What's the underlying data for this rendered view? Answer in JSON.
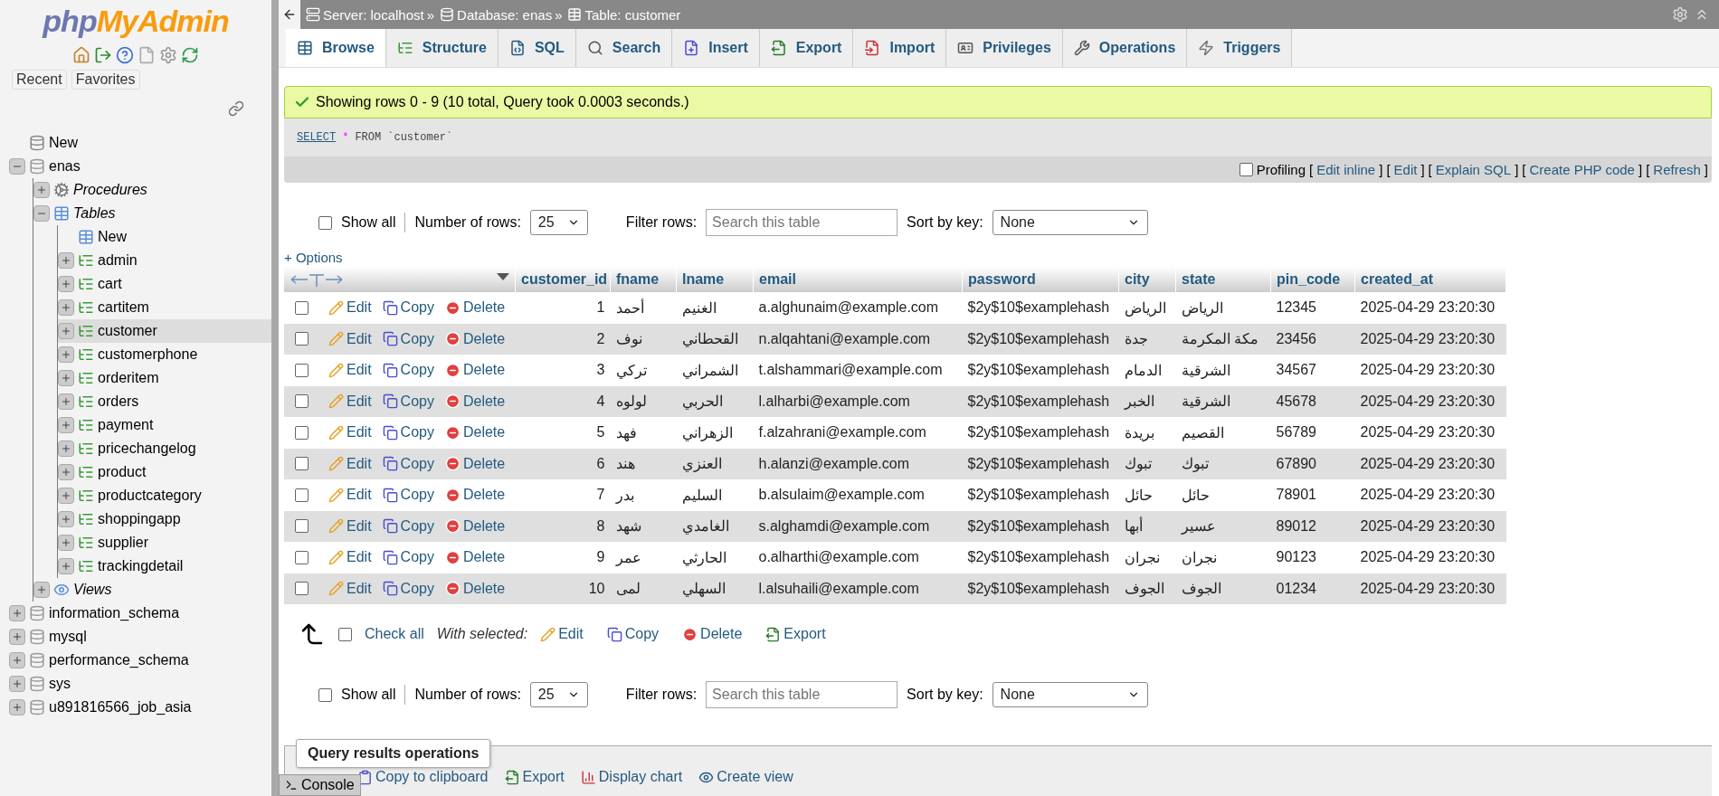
{
  "sidebar": {
    "logo": {
      "first": "php",
      "second": "MyAdmin"
    },
    "buttons": [
      "Recent",
      "Favorites"
    ],
    "tree": [
      {
        "label": "New",
        "kind": "new",
        "selected": false
      },
      {
        "label": "enas",
        "kind": "db",
        "expanded": true,
        "selected": false,
        "children": [
          {
            "label": "Procedures",
            "kind": "procedures",
            "expanded": false,
            "selected": false
          },
          {
            "label": "Tables",
            "kind": "tables",
            "expanded": true,
            "selected": false,
            "children": [
              {
                "label": "New",
                "kind": "newtable",
                "selected": false
              },
              {
                "label": "admin",
                "kind": "table",
                "expanded": false,
                "selected": false
              },
              {
                "label": "cart",
                "kind": "table",
                "expanded": false,
                "selected": false
              },
              {
                "label": "cartitem",
                "kind": "table",
                "expanded": false,
                "selected": false
              },
              {
                "label": "customer",
                "kind": "table",
                "expanded": false,
                "selected": true
              },
              {
                "label": "customerphone",
                "kind": "table",
                "expanded": false,
                "selected": false
              },
              {
                "label": "orderitem",
                "kind": "table",
                "expanded": false,
                "selected": false
              },
              {
                "label": "orders",
                "kind": "table",
                "expanded": false,
                "selected": false
              },
              {
                "label": "payment",
                "kind": "table",
                "expanded": false,
                "selected": false
              },
              {
                "label": "pricechangelog",
                "kind": "table",
                "expanded": false,
                "selected": false
              },
              {
                "label": "product",
                "kind": "table",
                "expanded": false,
                "selected": false
              },
              {
                "label": "productcategory",
                "kind": "table",
                "expanded": false,
                "selected": false
              },
              {
                "label": "shoppingapp",
                "kind": "table",
                "expanded": false,
                "selected": false
              },
              {
                "label": "supplier",
                "kind": "table",
                "expanded": false,
                "selected": false
              },
              {
                "label": "trackingdetail",
                "kind": "table",
                "expanded": false,
                "selected": false
              }
            ]
          },
          {
            "label": "Views",
            "kind": "views",
            "expanded": false,
            "selected": false
          }
        ]
      },
      {
        "label": "information_schema",
        "kind": "db",
        "expanded": false,
        "selected": false
      },
      {
        "label": "mysql",
        "kind": "db",
        "expanded": false,
        "selected": false
      },
      {
        "label": "performance_schema",
        "kind": "db",
        "expanded": false,
        "selected": false
      },
      {
        "label": "sys",
        "kind": "db",
        "expanded": false,
        "selected": false
      },
      {
        "label": "u891816566_job_asia",
        "kind": "db",
        "expanded": false,
        "selected": false
      }
    ]
  },
  "breadcrumb": [
    {
      "kind": "server",
      "label": "Server: localhost",
      "sep": "»"
    },
    {
      "kind": "database",
      "label": "Database: enas",
      "sep": "»"
    },
    {
      "kind": "table",
      "label": "Table: customer"
    }
  ],
  "tabs": [
    {
      "kind": "browse",
      "label": "Browse",
      "selected": true
    },
    {
      "kind": "structure",
      "label": "Structure",
      "selected": false
    },
    {
      "kind": "sql",
      "label": "SQL",
      "selected": false
    },
    {
      "kind": "search",
      "label": "Search",
      "selected": false
    },
    {
      "kind": "insert",
      "label": "Insert",
      "selected": false
    },
    {
      "kind": "export",
      "label": "Export",
      "selected": false
    },
    {
      "kind": "import",
      "label": "Import",
      "selected": false
    },
    {
      "kind": "privileges",
      "label": "Privileges",
      "selected": false
    },
    {
      "kind": "operations",
      "label": "Operations",
      "selected": false
    },
    {
      "kind": "triggers",
      "label": "Triggers",
      "selected": false
    }
  ],
  "message": "Showing rows 0 - 9 (10 total, Query took 0.0003 seconds.)",
  "sql": [
    {
      "kind": "keyword",
      "text": "SELECT"
    },
    {
      "kind": "operator",
      "text": "*"
    },
    {
      "kind": "plain",
      "text": "FROM"
    },
    {
      "kind": "identifier",
      "text": "`customer`"
    }
  ],
  "profiling": {
    "label": "Profiling",
    "checked": false,
    "links": [
      {
        "open": "[",
        "label": "Edit inline",
        "close": "]"
      },
      {
        "open": "[",
        "label": "Edit",
        "close": "]"
      },
      {
        "open": "[",
        "label": "Explain SQL",
        "close": "]"
      },
      {
        "open": "[",
        "label": "Create PHP code",
        "close": "]"
      },
      {
        "open": "[",
        "label": "Refresh",
        "close": "]"
      }
    ]
  },
  "nav_top": {
    "show_all": "Show all",
    "show_all_checked": false,
    "rows_label": "Number of rows:",
    "rows_value": "25",
    "filter_label": "Filter rows:",
    "placeholder": "Search this table",
    "sort_label": "Sort by key:",
    "sort_value": "None"
  },
  "options": "+ Options",
  "table": {
    "columns": [
      "customer_id",
      "fname",
      "lname",
      "email",
      "password",
      "city",
      "state",
      "pin_code",
      "created_at"
    ],
    "rows": [
      {
        "checked": false,
        "actions": [
          "Edit",
          "Copy",
          "Delete"
        ],
        "cells": [
          "1",
          "أحمد",
          "الغنيم",
          "a.alghunaim@example.com",
          "$2y$10$examplehash",
          "الرياض",
          "الرياض",
          "12345",
          "2025-04-29 23:20:30"
        ]
      },
      {
        "checked": false,
        "actions": [
          "Edit",
          "Copy",
          "Delete"
        ],
        "cells": [
          "2",
          "نوف",
          "القحطاني",
          "n.alqahtani@example.com",
          "$2y$10$examplehash",
          "جدة",
          "مكة المكرمة",
          "23456",
          "2025-04-29 23:20:30"
        ]
      },
      {
        "checked": false,
        "actions": [
          "Edit",
          "Copy",
          "Delete"
        ],
        "cells": [
          "3",
          "تركي",
          "الشمراني",
          "t.alshammari@example.com",
          "$2y$10$examplehash",
          "الدمام",
          "الشرقية",
          "34567",
          "2025-04-29 23:20:30"
        ]
      },
      {
        "checked": false,
        "actions": [
          "Edit",
          "Copy",
          "Delete"
        ],
        "cells": [
          "4",
          "لولوه",
          "الحربي",
          "l.alharbi@example.com",
          "$2y$10$examplehash",
          "الخبر",
          "الشرقية",
          "45678",
          "2025-04-29 23:20:30"
        ]
      },
      {
        "checked": false,
        "actions": [
          "Edit",
          "Copy",
          "Delete"
        ],
        "cells": [
          "5",
          "فهد",
          "الزهراني",
          "f.alzahrani@example.com",
          "$2y$10$examplehash",
          "بريدة",
          "القصيم",
          "56789",
          "2025-04-29 23:20:30"
        ]
      },
      {
        "checked": false,
        "actions": [
          "Edit",
          "Copy",
          "Delete"
        ],
        "cells": [
          "6",
          "هند",
          "العنزي",
          "h.alanzi@example.com",
          "$2y$10$examplehash",
          "تبوك",
          "تبوك",
          "67890",
          "2025-04-29 23:20:30"
        ]
      },
      {
        "checked": false,
        "actions": [
          "Edit",
          "Copy",
          "Delete"
        ],
        "cells": [
          "7",
          "بدر",
          "السليم",
          "b.alsulaim@example.com",
          "$2y$10$examplehash",
          "حائل",
          "حائل",
          "78901",
          "2025-04-29 23:20:30"
        ]
      },
      {
        "checked": false,
        "actions": [
          "Edit",
          "Copy",
          "Delete"
        ],
        "cells": [
          "8",
          "شهد",
          "الغامدي",
          "s.alghamdi@example.com",
          "$2y$10$examplehash",
          "أبها",
          "عسير",
          "89012",
          "2025-04-29 23:20:30"
        ]
      },
      {
        "checked": false,
        "actions": [
          "Edit",
          "Copy",
          "Delete"
        ],
        "cells": [
          "9",
          "عمر",
          "الحارثي",
          "o.alharthi@example.com",
          "$2y$10$examplehash",
          "نجران",
          "نجران",
          "90123",
          "2025-04-29 23:20:30"
        ]
      },
      {
        "checked": false,
        "actions": [
          "Edit",
          "Copy",
          "Delete"
        ],
        "cells": [
          "10",
          "لمى",
          "السهلي",
          "l.alsuhaili@example.com",
          "$2y$10$examplehash",
          "الجوف",
          "الجوف",
          "01234",
          "2025-04-29 23:20:30"
        ]
      }
    ]
  },
  "bulk": {
    "check_all": "Check all",
    "checked": false,
    "with_selected": "With selected:",
    "actions": [
      {
        "kind": "edit",
        "label": "Edit"
      },
      {
        "kind": "copy",
        "label": "Copy"
      },
      {
        "kind": "delete",
        "label": "Delete"
      },
      {
        "kind": "export",
        "label": "Export"
      }
    ]
  },
  "nav_bottom": {
    "show_all": "Show all",
    "show_all_checked": false,
    "rows_label": "Number of rows:",
    "rows_value": "25",
    "filter_label": "Filter rows:",
    "placeholder": "Search this table",
    "sort_label": "Sort by key:",
    "sort_value": "None"
  },
  "operations": {
    "title": "Query results operations",
    "items": [
      {
        "kind": "copy",
        "label": "Copy to clipboard"
      },
      {
        "kind": "export",
        "label": "Export"
      },
      {
        "kind": "chart",
        "label": "Display chart"
      },
      {
        "kind": "view",
        "label": "Create view"
      }
    ]
  },
  "console": "Console"
}
